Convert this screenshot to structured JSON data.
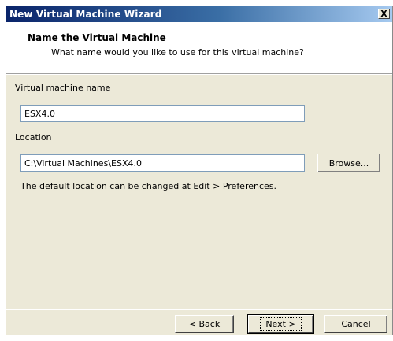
{
  "window": {
    "title": "New Virtual Machine Wizard",
    "close_glyph": "X"
  },
  "header": {
    "title": "Name the Virtual Machine",
    "subtitle": "What name would you like to use for this virtual machine?"
  },
  "form": {
    "vm_name_label": "Virtual machine name",
    "vm_name_value": "ESX4.0",
    "location_label": "Location",
    "location_value": "C:\\Virtual Machines\\ESX4.0",
    "browse_label": "Browse...",
    "hint": "The default location can be changed at Edit > Preferences."
  },
  "footer": {
    "back_label": "< Back",
    "next_label": "Next >",
    "cancel_label": "Cancel"
  }
}
